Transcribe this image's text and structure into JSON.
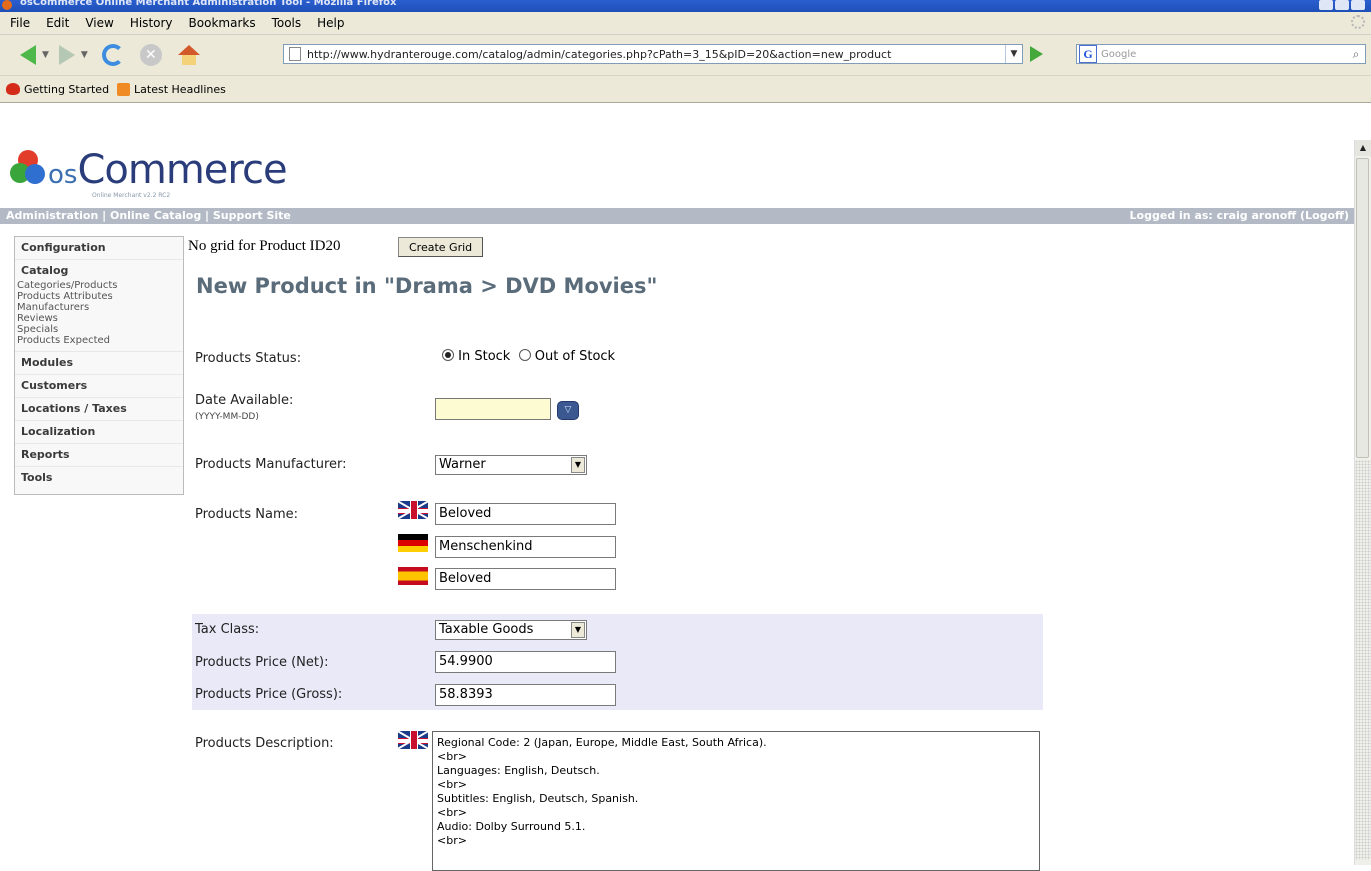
{
  "window": {
    "title": "osCommerce Online Merchant Administration Tool - Mozilla Firefox"
  },
  "menu": [
    "File",
    "Edit",
    "View",
    "History",
    "Bookmarks",
    "Tools",
    "Help"
  ],
  "nav": {
    "url": "http://www.hydranterouge.com/catalog/admin/categories.php?cPath=3_15&pID=20&action=new_product",
    "search_placeholder": "Google"
  },
  "bookmarks": [
    "Getting Started",
    "Latest Headlines"
  ],
  "logo": {
    "os": "os",
    "word": "Commerce",
    "tagline": "Online Merchant v2.2 RC2"
  },
  "header": {
    "links": "Administration | Online Catalog | Support Site",
    "logged_in": "Logged in as: craig aronoff (Logoff)"
  },
  "sidebar": {
    "configuration": "Configuration",
    "catalog": "Catalog",
    "catalog_items": [
      "Categories/Products",
      "Products Attributes",
      "Manufacturers",
      "Reviews",
      "Specials",
      "Products Expected"
    ],
    "modules": "Modules",
    "customers": "Customers",
    "locations": "Locations / Taxes",
    "localization": "Localization",
    "reports": "Reports",
    "tools": "Tools"
  },
  "main": {
    "no_grid": "No grid for Product ID20",
    "create_grid": "Create Grid",
    "title": "New Product in \"Drama > DVD Movies\"",
    "status_label": "Products Status:",
    "in_stock": "In Stock",
    "out_of_stock": "Out of Stock",
    "date_label": "Date Available:",
    "date_hint": "(YYYY-MM-DD)",
    "date_value": "",
    "manufacturer_label": "Products Manufacturer:",
    "manufacturer_value": "Warner",
    "name_label": "Products Name:",
    "names": [
      "Beloved",
      "Menschenkind",
      "Beloved"
    ],
    "tax_label": "Tax Class:",
    "tax_value": "Taxable Goods",
    "price_net_label": "Products Price (Net):",
    "price_net": "54.9900",
    "price_gross_label": "Products Price (Gross):",
    "price_gross": "58.8393",
    "desc_label": "Products Description:",
    "description": "Regional Code: 2 (Japan, Europe, Middle East, South Africa).\n<br>\nLanguages: English, Deutsch.\n<br>\nSubtitles: English, Deutsch, Spanish.\n<br>\nAudio: Dolby Surround 5.1.\n<br>"
  }
}
